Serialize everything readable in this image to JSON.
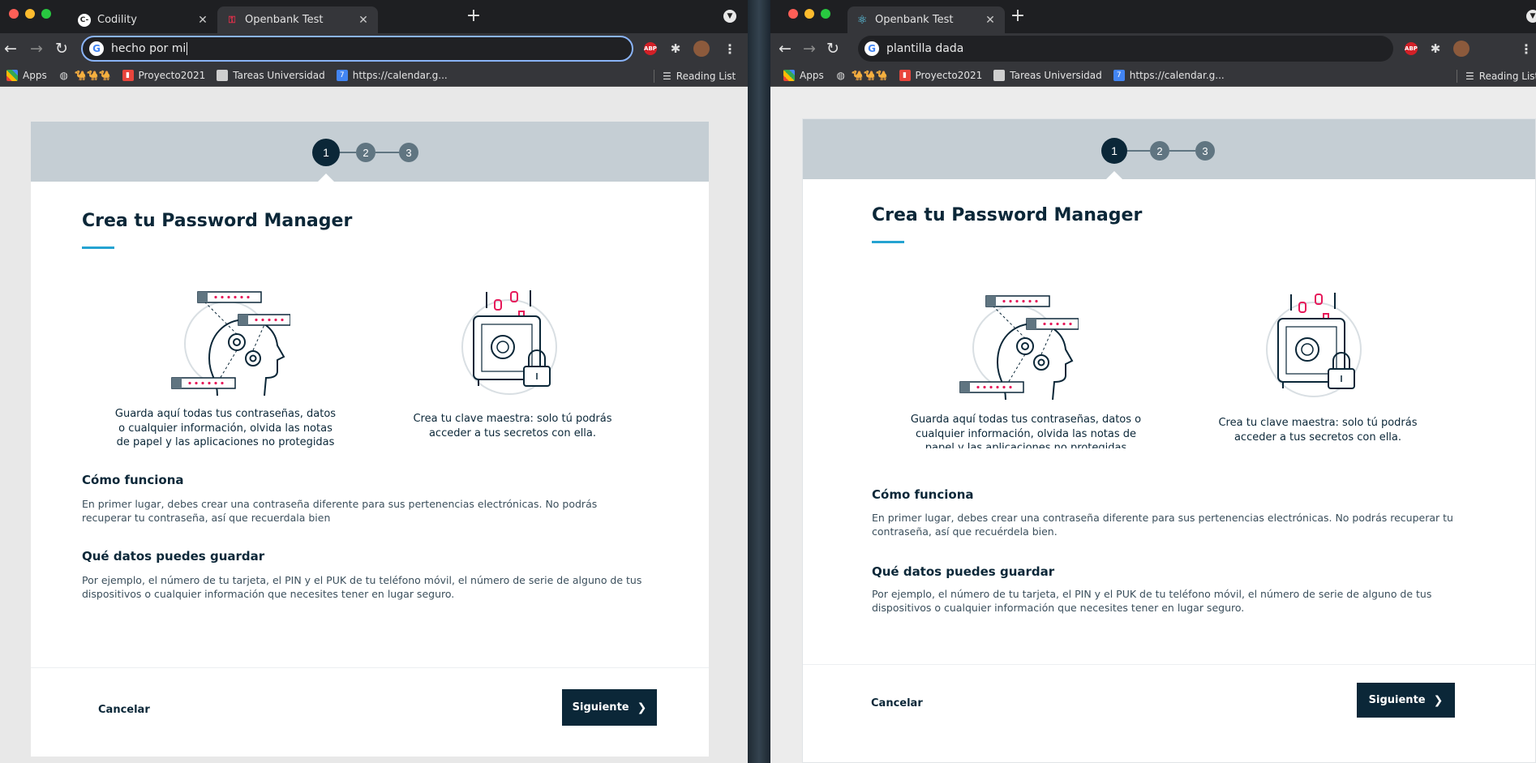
{
  "left": {
    "tabs": [
      {
        "label": "Codility",
        "icon": "codility-icon"
      },
      {
        "label": "Openbank Test",
        "icon": "key-icon"
      }
    ],
    "address": "hecho por mi"
  },
  "right": {
    "tabs": [
      {
        "label": "Openbank Test",
        "icon": "react-icon"
      }
    ],
    "address": "plantilla dada"
  },
  "bookmarks": {
    "apps": "Apps",
    "camels": "🐪🐪🐪",
    "proyecto": "Proyecto2021",
    "tareas": "Tareas Universidad",
    "calendar": "https://calendar.g...",
    "reading": "Reading List"
  },
  "extensions": {
    "abp": "ABP"
  },
  "page": {
    "steps": [
      "1",
      "2",
      "3"
    ],
    "current_step": 1,
    "title": "Crea tu Password Manager",
    "feature1": "Guarda aquí todas tus contraseñas, datos o cualquier información, olvida las notas de papel y las aplicaciones no protegidas",
    "feature2": "Crea tu clave maestra: solo tú podrás acceder a tus secretos con ella.",
    "how_title": "Cómo funciona",
    "what_title": "Qué datos puedes guardar",
    "cancel": "Cancelar",
    "next": "Siguiente",
    "next_chevron": "❯"
  },
  "left_page": {
    "how_text": "En primer lugar, debes crear una contraseña diferente para sus pertenencias electrónicas. No podrás recuperar tu contraseña, así que recuerdala bien",
    "what_text": "Por ejemplo, el número de tu tarjeta, el PIN y el PUK de tu teléfono móvil, el número de serie de alguno de tus dispositivos o cualquier información que necesites tener en lugar seguro."
  },
  "right_page": {
    "how_text": "En primer lugar, debes crear una contraseña diferente para sus pertenencias electrónicas. No podrás recuperar tu contraseña, así que recuérdela bien.",
    "what_text": "Por ejemplo, el número de tu tarjeta, el PIN y el PUK de tu teléfono móvil, el número de serie de alguno de tus dispositivos o cualquier información que necesites tener en lugar seguro."
  },
  "colors": {
    "primary": "#0b2738",
    "accent": "#25a3d1",
    "stepbar": "#c5ced4",
    "inactive_step": "#607581",
    "pink": "#e6195a"
  }
}
